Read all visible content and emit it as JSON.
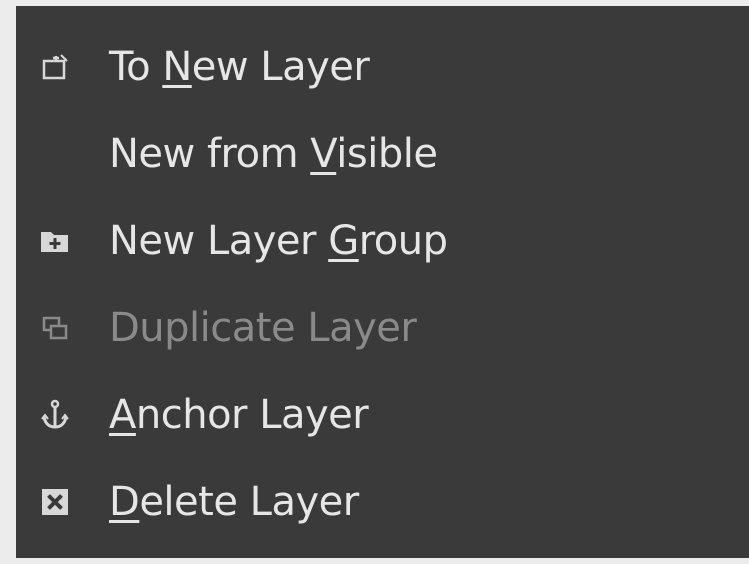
{
  "menu": {
    "items": [
      {
        "pre": "To ",
        "key": "N",
        "post": "ew Layer",
        "icon": "to-new-layer-icon",
        "enabled": true
      },
      {
        "pre": "New from ",
        "key": "V",
        "post": "isible",
        "icon": "",
        "enabled": true
      },
      {
        "pre": "New Layer ",
        "key": "G",
        "post": "roup",
        "icon": "new-layer-group-icon",
        "enabled": true
      },
      {
        "pre": "Duplicate Layer",
        "key": "",
        "post": "",
        "icon": "duplicate-layer-icon",
        "enabled": false
      },
      {
        "pre": "",
        "key": "A",
        "post": "nchor Layer",
        "icon": "anchor-icon",
        "enabled": true
      },
      {
        "pre": "",
        "key": "D",
        "post": "elete Layer",
        "icon": "delete-icon",
        "enabled": true
      }
    ]
  },
  "colors": {
    "menu_background": "#3a3a3a",
    "text": "#e6e6e6",
    "text_disabled": "#8a8a8a"
  }
}
